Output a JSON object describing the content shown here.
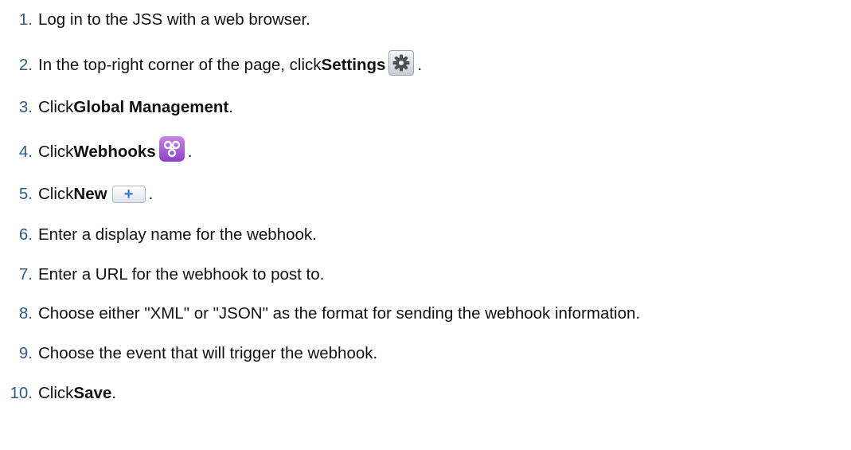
{
  "steps": [
    {
      "number": "1.",
      "text": "Log in to the JSS with a web browser."
    },
    {
      "number": "2.",
      "text_before": "In the top-right corner of the page, click ",
      "bold": "Settings",
      "icon": "gear-icon",
      "text_after": "."
    },
    {
      "number": "3.",
      "text_before": "Click ",
      "bold": "Global Management",
      "text_after": "."
    },
    {
      "number": "4.",
      "text_before": "Click ",
      "bold": "Webhooks",
      "icon": "webhooks-icon",
      "text_after": "."
    },
    {
      "number": "5.",
      "text_before": "Click ",
      "bold": "New",
      "icon": "plus-icon",
      "icon_glyph": "+",
      "text_after": "."
    },
    {
      "number": "6.",
      "text": "Enter a display name for the webhook."
    },
    {
      "number": "7.",
      "text": "Enter a URL for the webhook to post to."
    },
    {
      "number": "8.",
      "text": "Choose either \"XML\" or \"JSON\" as the format for sending the webhook information."
    },
    {
      "number": "9.",
      "text": "Choose the event that will trigger the webhook."
    },
    {
      "number": "10.",
      "text_before": "Click ",
      "bold": "Save",
      "text_after": "."
    }
  ],
  "colors": {
    "step_number": "#2c5b8f",
    "text": "#111111",
    "webhooks_icon": "#a561d8",
    "plus_icon": "#2f7bd4"
  }
}
